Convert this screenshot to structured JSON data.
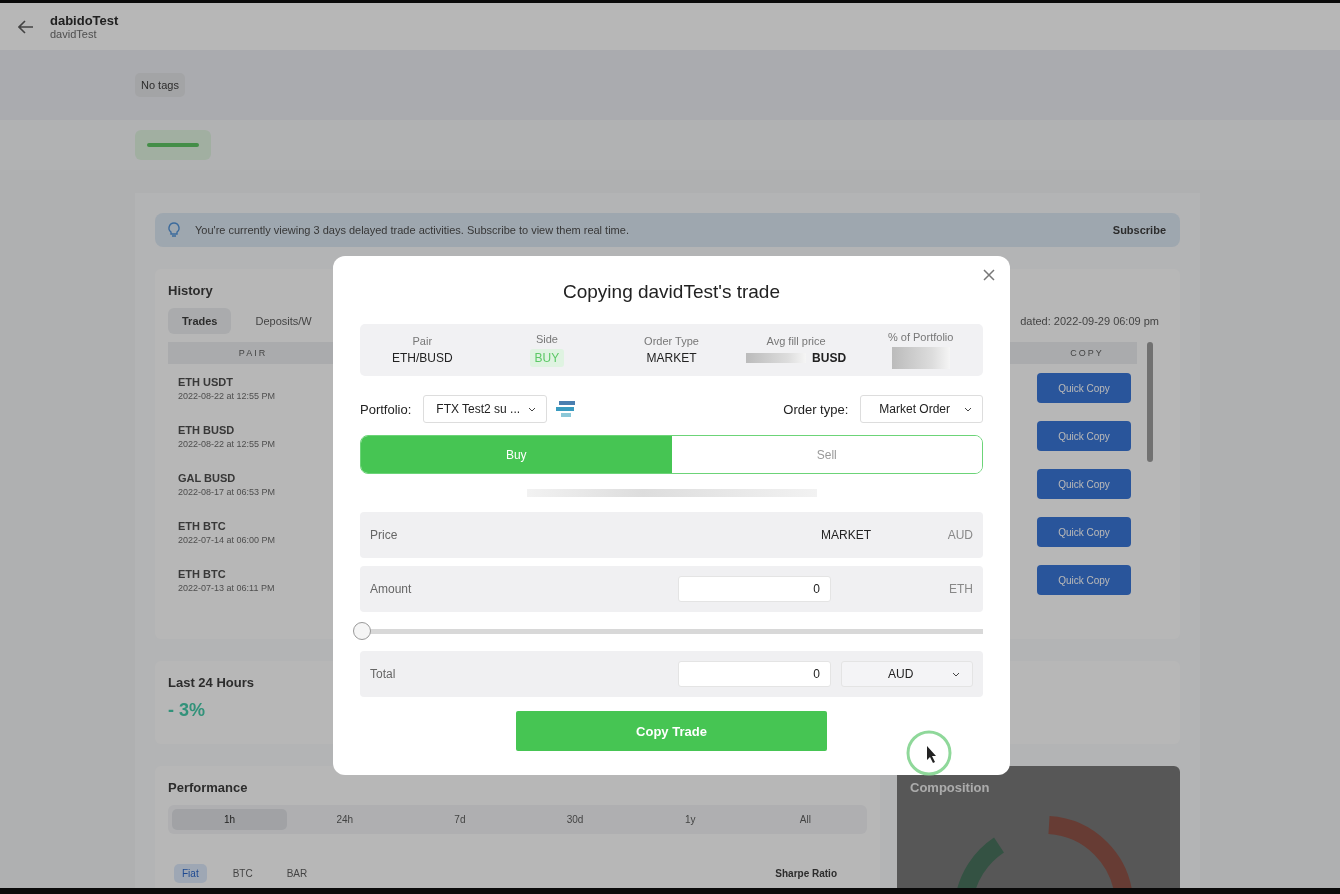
{
  "header": {
    "title": "dabidoTest",
    "subtitle": "davidTest"
  },
  "tags_label": "No tags",
  "banner": {
    "text": "You're currently viewing 3 days delayed trade activities. Subscribe to view them real time.",
    "action": "Subscribe"
  },
  "history": {
    "title": "History",
    "tabs": [
      {
        "label": "Trades",
        "selected": true
      },
      {
        "label": "Deposits/W",
        "selected": false
      }
    ],
    "updated": "dated: 2022-09-29 06:09 pm",
    "columns": [
      "PAIR",
      "COPY"
    ],
    "rows": [
      {
        "pair": "ETH USDT",
        "date": "2022-08-22 at 12:55 PM",
        "action": "Quick Copy"
      },
      {
        "pair": "ETH BUSD",
        "date": "2022-08-22 at 12:55 PM",
        "action": "Quick Copy"
      },
      {
        "pair": "GAL BUSD",
        "date": "2022-08-17 at 06:53 PM",
        "action": "Quick Copy"
      },
      {
        "pair": "ETH BTC",
        "date": "2022-07-14 at 06:00 PM",
        "action": "Quick Copy"
      },
      {
        "pair": "ETH BTC",
        "date": "2022-07-13 at 06:11 PM",
        "action": "Quick Copy"
      }
    ]
  },
  "last_24h": {
    "title": "Last 24 Hours",
    "change": "- 3%"
  },
  "performance": {
    "title": "Performance",
    "periods": [
      {
        "label": "1h",
        "selected": true
      },
      {
        "label": "24h",
        "selected": false
      },
      {
        "label": "7d",
        "selected": false
      },
      {
        "label": "30d",
        "selected": false
      },
      {
        "label": "1y",
        "selected": false
      },
      {
        "label": "All",
        "selected": false
      }
    ],
    "units": [
      {
        "label": "Fiat",
        "selected": true
      },
      {
        "label": "BTC",
        "selected": false
      },
      {
        "label": "BAR",
        "selected": false
      }
    ],
    "metric": "Sharpe Ratio"
  },
  "composition": {
    "title": "Composition"
  },
  "modal": {
    "title": "Copying davidTest's trade",
    "summary": [
      {
        "label": "Pair",
        "value": "ETH/BUSD",
        "kind": "text"
      },
      {
        "label": "Side",
        "value": "BUY",
        "kind": "badge"
      },
      {
        "label": "Order Type",
        "value": "MARKET",
        "kind": "text"
      },
      {
        "label": "Avg fill price",
        "value": "BUSD",
        "kind": "hidden_amount"
      },
      {
        "label": "% of Portfolio",
        "kind": "hidden"
      }
    ],
    "portfolio": {
      "label": "Portfolio:",
      "value": "FTX Test2 su ..."
    },
    "order_type": {
      "label": "Order type:",
      "value": "Market Order"
    },
    "sides": [
      {
        "label": "Buy",
        "selected": true
      },
      {
        "label": "Sell",
        "selected": false
      }
    ],
    "price": {
      "label": "Price",
      "value": "MARKET",
      "unit": "AUD"
    },
    "amount": {
      "label": "Amount",
      "value": "0",
      "unit": "ETH"
    },
    "slider": {
      "level": 0
    },
    "total": {
      "label": "Total",
      "value": "0",
      "currency": "AUD"
    },
    "submit": "Copy Trade"
  }
}
